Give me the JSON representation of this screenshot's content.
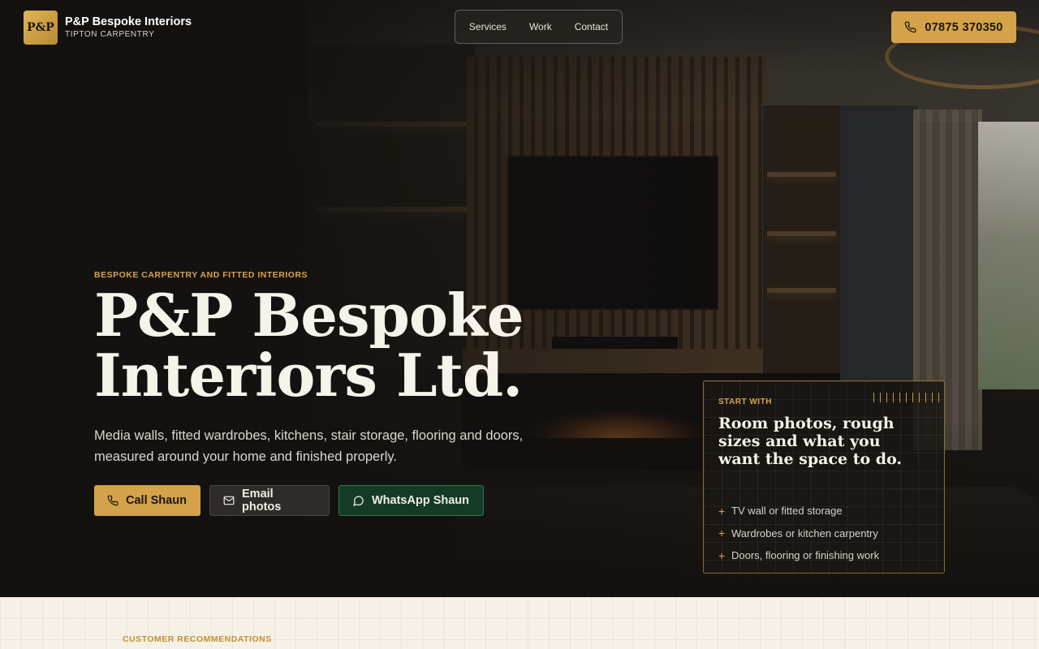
{
  "header": {
    "logo_text": "P&P",
    "brand_name": "P&P Bespoke Interiors",
    "brand_sub": "TIPTON CARPENTRY",
    "nav": [
      {
        "label": "Services"
      },
      {
        "label": "Work"
      },
      {
        "label": "Contact"
      }
    ],
    "phone": "07875 370350"
  },
  "hero": {
    "eyebrow": "BESPOKE CARPENTRY AND FITTED INTERIORS",
    "title": "P&P Bespoke Interiors Ltd.",
    "lede": "Media walls, fitted wardrobes, kitchens, stair storage, flooring and doors, measured around your home and finished properly.",
    "buttons": {
      "call": "Call Shaun",
      "email": "Email photos",
      "whatsapp": "WhatsApp Shaun"
    }
  },
  "start_card": {
    "eyebrow": "START WITH",
    "title": "Room photos, rough sizes and what you want the space to do.",
    "items": [
      "TV wall or fitted storage",
      "Wardrobes or kitchen carpentry",
      "Doors, flooring or finishing work"
    ]
  },
  "lower": {
    "eyebrow": "CUSTOMER RECOMMENDATIONS"
  },
  "colors": {
    "accent": "#d4a24a",
    "dark_bg": "#151311",
    "cream_bg": "#f6f1e7",
    "whatsapp_green": "#133b26"
  },
  "icons": {
    "phone": "phone-icon",
    "email": "envelope-icon",
    "whatsapp": "chat-bubble-icon",
    "list_bullet": "plus-icon"
  }
}
